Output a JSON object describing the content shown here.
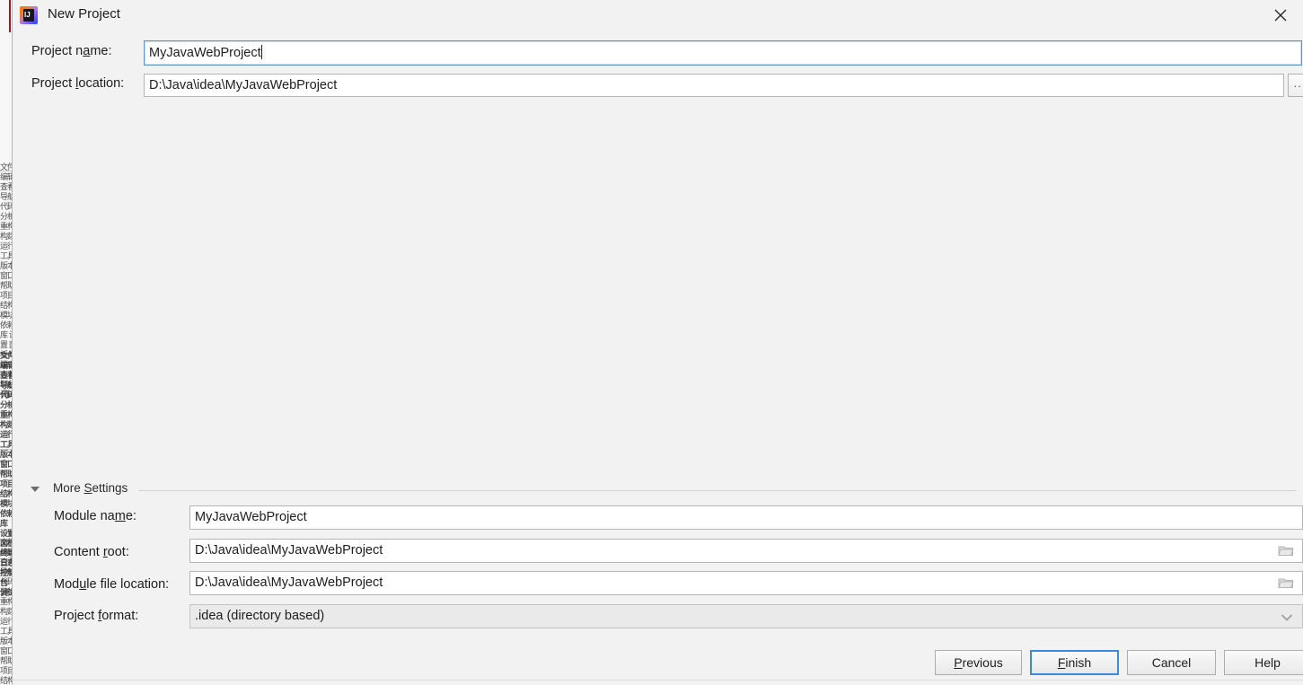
{
  "window": {
    "title": "New Project",
    "app_icon": "intellij-idea-icon",
    "close_icon": "close-icon"
  },
  "top_form": {
    "project_name": {
      "label_before": "Project n",
      "label_mnemonic": "a",
      "label_after": "me:",
      "value": "MyJavaWebProject"
    },
    "project_location": {
      "label_before": "Project ",
      "label_mnemonic": "l",
      "label_after": "ocation:",
      "value": "D:\\Java\\idea\\MyJavaWebProject",
      "browse_label": "..."
    }
  },
  "more_settings": {
    "header_before": "More ",
    "header_mnemonic": "S",
    "header_after": "ettings",
    "expanded": true,
    "fields": {
      "module_name": {
        "label_before": "Module na",
        "label_mnemonic": "m",
        "label_after": "e:",
        "value": "MyJavaWebProject"
      },
      "content_root": {
        "label_before": "Content ",
        "label_mnemonic": "r",
        "label_after": "oot:",
        "value": "D:\\Java\\idea\\MyJavaWebProject"
      },
      "module_file_location": {
        "label_before": "Mod",
        "label_mnemonic": "u",
        "label_after": "le file location:",
        "value": "D:\\Java\\idea\\MyJavaWebProject"
      },
      "project_format": {
        "label_before": "Project ",
        "label_mnemonic": "f",
        "label_after": "ormat:",
        "value": ".idea (directory based)",
        "options": [
          ".idea (directory based)"
        ]
      }
    }
  },
  "footer": {
    "previous_before": "",
    "previous_mnemonic": "P",
    "previous_after": "revious",
    "finish_before": "",
    "finish_mnemonic": "F",
    "finish_after": "inish",
    "cancel": "Cancel",
    "help": "Help",
    "focused_button": "finish"
  },
  "colors": {
    "dialog_background": "#f2f2f2",
    "field_background": "#ffffff",
    "field_border": "#b6b6b6",
    "focus_blue": "#3c8ae0",
    "focus_field_border": "#5b93d6",
    "text": "#1d1d1d",
    "disabled_control_background": "#eaeaea"
  },
  "background_bleed": {
    "strip_text": "文件 编辑 查看 导航 代码 分析 重构 构建 运行 工具 版本 窗口 帮助 项目 结构 模块 依赖 库 设置 面板 终端 日志 控制台 调试"
  }
}
